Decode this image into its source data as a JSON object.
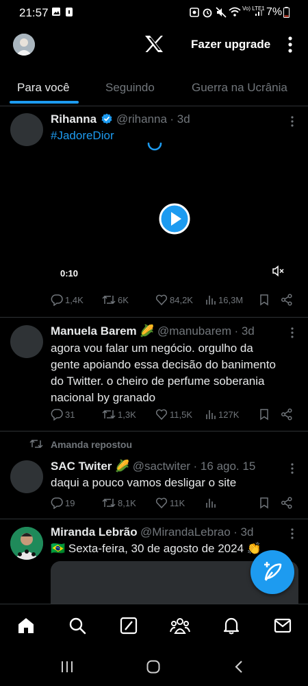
{
  "status_bar": {
    "time": "21:57",
    "battery": "7%",
    "network": "Vo) LTE1"
  },
  "header": {
    "upgrade_label": "Fazer upgrade"
  },
  "tabs": [
    {
      "label": "Para você",
      "active": true
    },
    {
      "label": "Seguindo",
      "active": false
    },
    {
      "label": "Guerra na Ucrânia",
      "active": false
    }
  ],
  "tweets": [
    {
      "name": "Rihanna",
      "verified": true,
      "handle": "@rihanna",
      "time": "· 3d",
      "text": "#JadoreDior",
      "video": {
        "duration": "0:10"
      },
      "stats": {
        "replies": "1,4K",
        "reposts": "6K",
        "likes": "84,2K",
        "views": "16,3M"
      }
    },
    {
      "name": "Manuela Barem 🌽",
      "handle": "@manubarem",
      "time": "· 3d",
      "text": "agora vou falar um negócio. orgulho da gente apoiando essa decisão do banimento do Twitter. o cheiro de perfume soberania nacional by granado",
      "stats": {
        "replies": "31",
        "reposts": "1,3K",
        "likes": "11,5K",
        "views": "127K"
      }
    },
    {
      "repost_label": "Amanda repostou",
      "name": "SAC Twiter 🌽",
      "handle": "@sactwiter",
      "time": "· 16 ago. 15",
      "text": "daqui a pouco vamos desligar o site",
      "stats": {
        "replies": "19",
        "reposts": "8,1K",
        "likes": "11K",
        "views": ""
      }
    },
    {
      "name": "Miranda Lebrão",
      "handle": "@MirandaLebrao",
      "time": "· 3d",
      "text": "🇧🇷 Sexta-feira, 30 de agosto de 2024 👏"
    }
  ],
  "colors": {
    "accent": "#1d9bf0",
    "muted": "#71767b",
    "text": "#e7e9ea",
    "divider": "#2f3336"
  }
}
